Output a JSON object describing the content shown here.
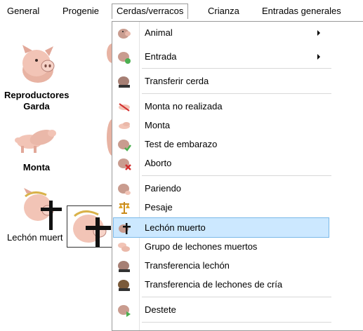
{
  "menubar": {
    "items": [
      "General",
      "Progenie",
      "Cerdas/verracos",
      "Crianza",
      "Entradas generales"
    ],
    "open_index": 2
  },
  "desktop": {
    "tiles": [
      {
        "label": "Reproductores\nGarda",
        "icon": "pig-head-icon"
      },
      {
        "label": "Monta",
        "icon": "mating-pigs-icon"
      },
      {
        "label": "Lechón muert",
        "icon": "dead-pig-cross-icon"
      }
    ]
  },
  "menu": {
    "items": [
      {
        "label": "Animal",
        "icon": "sow-icon",
        "submenu": true
      },
      {
        "label": "Entrada",
        "icon": "sow-entry-icon",
        "submenu": true
      },
      {
        "label": "Transferir cerda",
        "icon": "sow-transfer-icon"
      },
      {
        "label": "Monta no realizada",
        "icon": "mating-cancelled-icon"
      },
      {
        "label": "Monta",
        "icon": "mating-icon"
      },
      {
        "label": "Test de embarazo",
        "icon": "pregnancy-test-icon"
      },
      {
        "label": "Aborto",
        "icon": "abortion-icon"
      },
      {
        "label": "Pariendo",
        "icon": "farrowing-icon"
      },
      {
        "label": "Pesaje",
        "icon": "scale-icon"
      },
      {
        "label": "Lechón muerto",
        "icon": "dead-piglet-icon",
        "highlighted": true
      },
      {
        "label": "Grupo de lechones muertos",
        "icon": "dead-piglet-group-icon"
      },
      {
        "label": "Transferencia lechón",
        "icon": "piglet-transfer-icon"
      },
      {
        "label": "Transferencia de lechones de cría",
        "icon": "piglet-nurse-transfer-icon"
      },
      {
        "label": "Destete",
        "icon": "weaning-icon"
      }
    ]
  },
  "colors": {
    "highlight": "#cce8ff",
    "highlight_border": "#7ab8e8",
    "pig_pink": "#f2c4b6",
    "pig_dark": "#b9847a"
  }
}
